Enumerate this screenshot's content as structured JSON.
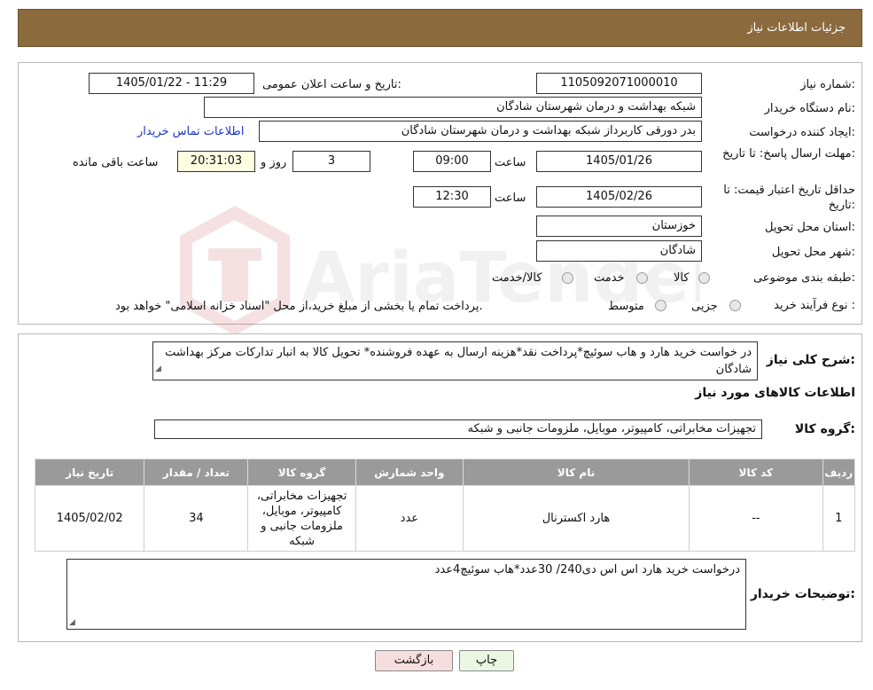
{
  "header": {
    "title": "جزئیات اطلاعات نیاز"
  },
  "form": {
    "need_number_label": "شماره نیاز:",
    "need_number": "1105092071000010",
    "announce_label": "تاریخ و ساعت اعلان عمومی:",
    "announce_value": "1405/01/22 - 11:29",
    "buyer_org_label": "نام دستگاه خریدار:",
    "buyer_org": "شبکه بهداشت و درمان شهرستان شادگان",
    "creator_label": "ایجاد کننده درخواست:",
    "creator": "بدر دورقی کاربرداز شبکه بهداشت و درمان شهرستان شادگان",
    "contact_link": "اطلاعات تماس خریدار",
    "deadline_label": "مهلت ارسال پاسخ: تا تاریخ:",
    "deadline_date": "1405/01/26",
    "time_label": "ساعت",
    "deadline_time": "09:00",
    "days_value": "3",
    "days_label": "روز و",
    "remaining_time": "20:31:03",
    "remaining_label": "ساعت باقی مانده",
    "validity_label": "حداقل تاریخ اعتبار قیمت: تا تاریخ:",
    "validity_date": "1405/02/26",
    "validity_time": "12:30",
    "province_label": "استان محل تحویل:",
    "province": "خوزستان",
    "city_label": "شهر محل تحویل:",
    "city": "شادگان",
    "category_label": "طبقه بندی موضوعی:",
    "category_options": [
      "کالا",
      "خدمت",
      "کالا/خدمت"
    ],
    "process_label": "نوع فرآیند خرید :",
    "process_options": [
      "جزیی",
      "متوسط"
    ],
    "process_note": "پرداخت تمام یا بخشی از مبلغ خرید،از محل \"اسناد خزانه اسلامی\" خواهد بود."
  },
  "detail": {
    "description_label": "شرح کلی نیاز:",
    "description": "در خواست خرید هارد و هاب سوئیچ*پرداخت نقد*هزینه ارسال به عهده فروشنده* تحویل کالا به انبار تدارکات مرکز بهداشت شادگان",
    "items_title": "اطلاعات کالاهای مورد نیاز",
    "group_label": "گروه کالا:",
    "group_value": "تجهیزات مخابراتی، کامپیوتر، موبایل، ملزومات جانبی و شبکه",
    "table_headers": [
      "ردیف",
      "کد کالا",
      "نام کالا",
      "واحد شمارش",
      "گروه کالا",
      "تعداد / مقدار",
      "تاریخ نیاز"
    ],
    "rows": [
      [
        "1",
        "--",
        "هارد اکسترنال",
        "عدد",
        "تجهیزات مخابراتی، کامپیوتر، موبایل، ملزومات جانبی و شبکه",
        "34",
        "1405/02/02"
      ]
    ],
    "buyer_notes_label": "توضیحات خریدار:",
    "buyer_notes": "درخواست خرید هارد اس اس دی240/ 30عدد*هاب سوئیچ4عدد"
  },
  "buttons": {
    "print": "چاپ",
    "back": "بازگشت"
  },
  "watermark_text": "AriaTender.neT",
  "colors": {
    "header": "#8b6a3e",
    "link": "#1a33cc",
    "table_header": "#9a9a9a",
    "back_button": "#f7dede",
    "print_button": "#eaf7e3"
  }
}
